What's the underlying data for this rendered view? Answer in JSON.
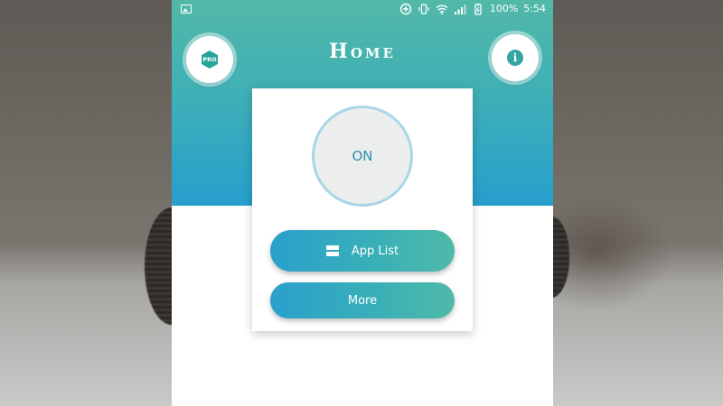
{
  "status_bar": {
    "battery_percent": "100%",
    "time": "5:54",
    "icons": [
      "gallery-icon",
      "add-circle-icon",
      "vibrate-icon",
      "wifi-icon",
      "signal-icon",
      "battery-icon"
    ]
  },
  "header": {
    "title": "Home",
    "pro_badge": "PRO",
    "info_glyph": "i"
  },
  "card": {
    "power_state": "ON",
    "app_list_label": "App List",
    "more_label": "More"
  },
  "colors": {
    "header_top": "#52b8a8",
    "header_bottom": "#279fce",
    "power_text": "#2d8fb0"
  }
}
